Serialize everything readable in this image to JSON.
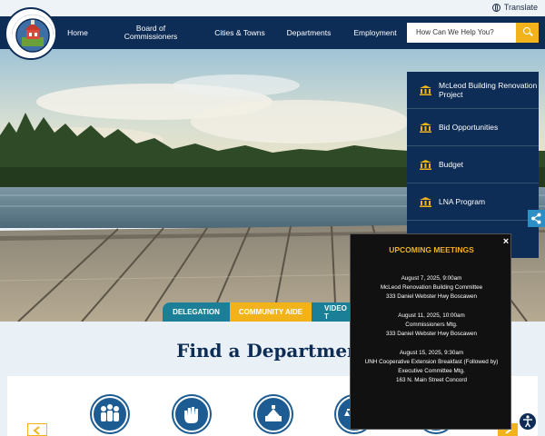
{
  "header": {
    "translate_label": "Translate",
    "logo_text": "MERRIMACK COUNTY NH",
    "logo_est": "EST 1823"
  },
  "nav": {
    "items": [
      {
        "label": "Home"
      },
      {
        "label": "Board of Commissioners"
      },
      {
        "label": "Cities & Towns"
      },
      {
        "label": "Departments"
      },
      {
        "label": "Employment"
      }
    ],
    "search_placeholder": "How Can We Help You?"
  },
  "quick_links": [
    {
      "label": "McLeod Building Renovation Project"
    },
    {
      "label": "Bid Opportunities"
    },
    {
      "label": "Budget"
    },
    {
      "label": "LNA Program"
    }
  ],
  "tabs": [
    {
      "label": "DELEGATION",
      "color": "#1b7f97"
    },
    {
      "label": "COMMUNITY AIDE",
      "color": "#f2b21a"
    },
    {
      "label": "VIDEO T",
      "color": "#1b7f97"
    }
  ],
  "departments": {
    "title": "Find a Department"
  },
  "meetings_popup": {
    "title": "UPCOMING MEETINGS",
    "close_label": "×",
    "meetings": [
      {
        "date": "August 7, 2025, 9:00am",
        "name": "McLeod Renovation Building Committee",
        "location": "333 Daniel Webster Hwy Boscawen"
      },
      {
        "date": "August 11, 2025, 10:00am",
        "name": "Commissioners Mtg.",
        "location": "333 Daniel Webster Hwy Boscawen"
      },
      {
        "date": "August 15, 2025, 9:30am",
        "name": "UNH Cooperative Extension Breakfast (Followed by) Executive Committee Mtg.",
        "location": "163 N. Main Street Concord"
      }
    ]
  },
  "colors": {
    "navy": "#0d2c56",
    "gold": "#f2b21a",
    "teal": "#1b7f97"
  }
}
